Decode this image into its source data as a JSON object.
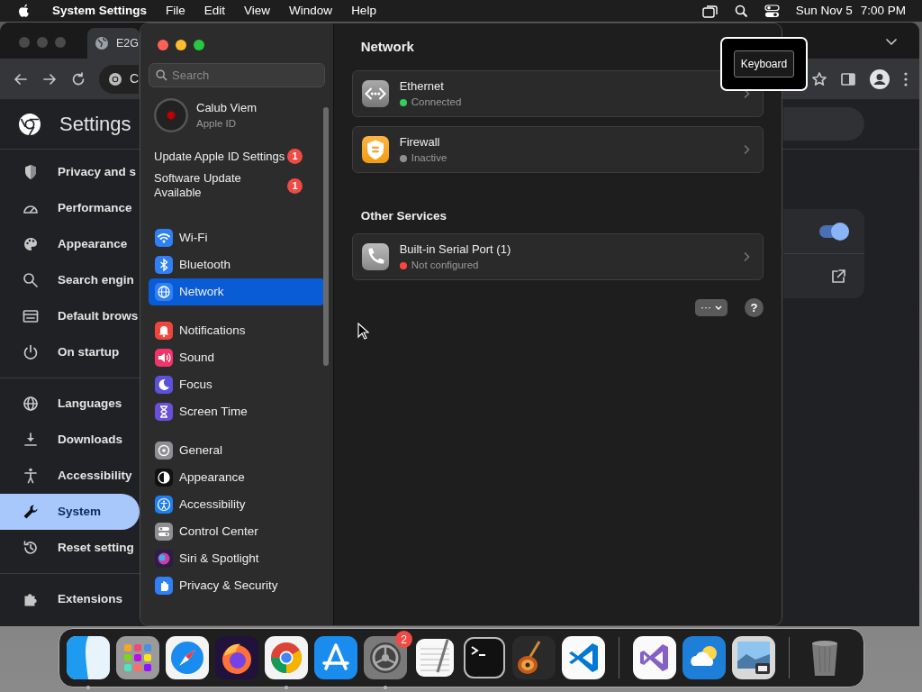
{
  "menubar": {
    "app_name": "System Settings",
    "menus": [
      "File",
      "Edit",
      "View",
      "Window",
      "Help"
    ],
    "date": "Sun Nov 5",
    "time": "7:00 PM"
  },
  "browser": {
    "tab_title": "E2G",
    "address": "C",
    "page_title": "Settings",
    "nav_sections": [
      [
        {
          "label": "Privacy and s",
          "selected": false
        },
        {
          "label": "Performance",
          "selected": false
        },
        {
          "label": "Appearance",
          "selected": false
        },
        {
          "label": "Search engin",
          "selected": false
        },
        {
          "label": "Default brows",
          "selected": false
        },
        {
          "label": "On startup",
          "selected": false
        }
      ],
      [
        {
          "label": "Languages",
          "selected": false
        },
        {
          "label": "Downloads",
          "selected": false
        },
        {
          "label": "Accessibility",
          "selected": false
        },
        {
          "label": "System",
          "selected": true
        },
        {
          "label": "Reset setting",
          "selected": false
        }
      ],
      [
        {
          "label": "Extensions",
          "selected": false
        }
      ]
    ],
    "toggle": {
      "on": true
    }
  },
  "settings": {
    "search": {
      "placeholder": "Search"
    },
    "account": {
      "name": "Calub Viem",
      "subtitle": "Apple ID"
    },
    "alerts": [
      {
        "label": "Update Apple ID Settings",
        "badge": "1"
      },
      {
        "label": "Software Update Available",
        "badge": "1"
      }
    ],
    "groups": [
      [
        {
          "label": "Wi-Fi",
          "color": "#2f7ff5",
          "selected": false
        },
        {
          "label": "Bluetooth",
          "color": "#2f7ff5",
          "selected": false
        },
        {
          "label": "Network",
          "color": "#2f7ff5",
          "selected": true
        }
      ],
      [
        {
          "label": "Notifications",
          "color": "#f0453c",
          "selected": false
        },
        {
          "label": "Sound",
          "color": "#f0356b",
          "selected": false
        },
        {
          "label": "Focus",
          "color": "#5b52d8",
          "selected": false
        },
        {
          "label": "Screen Time",
          "color": "#6a4fd8",
          "selected": false
        }
      ],
      [
        {
          "label": "General",
          "color": "#8e8e93",
          "selected": false
        },
        {
          "label": "Appearance",
          "color": "#111111",
          "selected": false
        },
        {
          "label": "Accessibility",
          "color": "#1f7ef0",
          "selected": false
        },
        {
          "label": "Control Center",
          "color": "#8e8e93",
          "selected": false
        },
        {
          "label": "Siri & Spotlight",
          "color": "#2a1d48",
          "selected": false
        },
        {
          "label": "Privacy & Security",
          "color": "#2f7ff5",
          "selected": false
        }
      ]
    ],
    "pane": {
      "title": "Network",
      "services": [
        {
          "name": "Ethernet",
          "status": "Connected",
          "color": "#30d158"
        },
        {
          "name": "Firewall",
          "status": "Inactive",
          "color": "#8e8e93"
        }
      ],
      "other_title": "Other Services",
      "other_services": [
        {
          "name": "Built-in Serial Port (1)",
          "status": "Not configured",
          "color": "#ff453a"
        }
      ],
      "more_button": "···",
      "help_button": "?"
    }
  },
  "tooltip": {
    "label": "Keyboard"
  },
  "dock": {
    "apps": [
      {
        "running": true
      },
      {
        "running": false
      },
      {
        "running": false
      },
      {
        "running": false
      },
      {
        "running": true
      },
      {
        "running": false
      },
      {
        "running": true,
        "badge": "2"
      },
      {
        "running": false
      },
      {
        "running": false
      },
      {
        "running": false
      },
      {
        "running": false
      },
      {
        "running": false
      },
      {
        "running": false
      },
      {
        "running": false
      },
      {
        "running": false
      }
    ]
  }
}
